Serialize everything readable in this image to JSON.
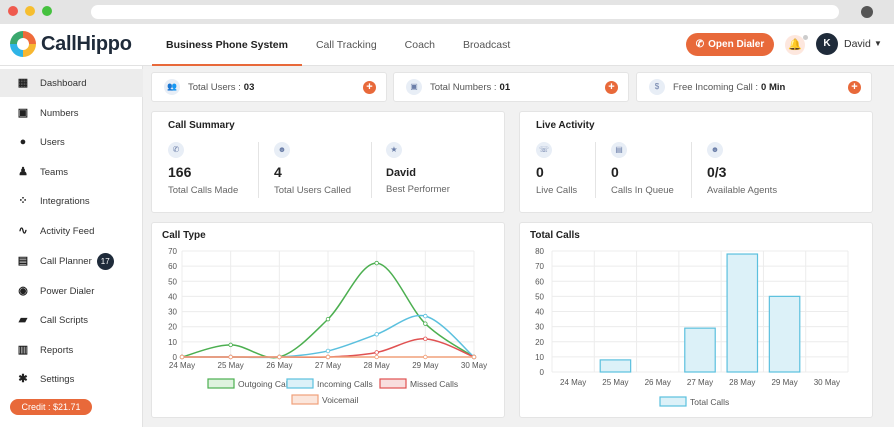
{
  "app": {
    "logo_text": "CallHippo"
  },
  "nav": {
    "tabs": [
      "Business Phone System",
      "Call Tracking",
      "Coach",
      "Broadcast"
    ]
  },
  "header": {
    "open_dialer": "Open Dialer",
    "avatar_initial": "K",
    "user_name": "David"
  },
  "sidebar": {
    "items": [
      {
        "label": "Dashboard",
        "icon": "dashboard-icon"
      },
      {
        "label": "Numbers",
        "icon": "numbers-icon"
      },
      {
        "label": "Users",
        "icon": "user-icon"
      },
      {
        "label": "Teams",
        "icon": "team-icon"
      },
      {
        "label": "Integrations",
        "icon": "integrations-icon"
      },
      {
        "label": "Activity Feed",
        "icon": "activity-icon"
      },
      {
        "label": "Call Planner",
        "icon": "calendar-icon",
        "badge": "17"
      },
      {
        "label": "Power Dialer",
        "icon": "power-dialer-icon"
      },
      {
        "label": "Call Scripts",
        "icon": "script-icon"
      },
      {
        "label": "Reports",
        "icon": "reports-icon"
      },
      {
        "label": "Settings",
        "icon": "gear-icon"
      }
    ],
    "credit": "Credit : $21.71"
  },
  "stats": {
    "total_users_label": "Total Users :",
    "total_users_value": "03",
    "total_numbers_label": "Total Numbers :",
    "total_numbers_value": "01",
    "free_incoming_label": "Free Incoming Call :",
    "free_incoming_value": "0 Min"
  },
  "call_summary": {
    "title": "Call Summary",
    "total_calls_made": "166",
    "total_calls_made_label": "Total Calls Made",
    "total_users_called": "4",
    "total_users_called_label": "Total Users Called",
    "best_performer": "David",
    "best_performer_label": "Best Performer"
  },
  "live_activity": {
    "title": "Live Activity",
    "live_calls": "0",
    "live_calls_label": "Live Calls",
    "calls_in_queue": "0",
    "calls_in_queue_label": "Calls In Queue",
    "available_agents": "0/3",
    "available_agents_label": "Available Agents"
  },
  "colors": {
    "accent": "#e8693a",
    "outgoing": "#4caf50",
    "incoming": "#5bc0de",
    "missed": "#e05252",
    "voicemail": "#f0a07a",
    "total": "#5bc0de"
  },
  "chart_data": [
    {
      "type": "line",
      "title": "Call Type",
      "categories": [
        "24 May",
        "25 May",
        "26 May",
        "27 May",
        "28 May",
        "29 May",
        "30 May"
      ],
      "ylim": [
        0,
        70
      ],
      "yticks": [
        0,
        10,
        20,
        30,
        40,
        50,
        60,
        70
      ],
      "grid": true,
      "legend_position": "bottom",
      "series": [
        {
          "name": "Outgoing Calls",
          "values": [
            0,
            8,
            0,
            25,
            62,
            22,
            0
          ]
        },
        {
          "name": "Incoming Calls",
          "values": [
            0,
            0,
            0,
            4,
            15,
            27,
            0
          ]
        },
        {
          "name": "Missed Calls",
          "values": [
            0,
            0,
            0,
            0,
            3,
            12,
            0
          ]
        },
        {
          "name": "Voicemail",
          "values": [
            0,
            0,
            0,
            0,
            0,
            0,
            0
          ]
        }
      ]
    },
    {
      "type": "bar",
      "title": "Total Calls",
      "categories": [
        "24 May",
        "25 May",
        "26 May",
        "27 May",
        "28 May",
        "29 May",
        "30 May"
      ],
      "ylim": [
        0,
        80
      ],
      "yticks": [
        0,
        10,
        20,
        30,
        40,
        50,
        60,
        70,
        80
      ],
      "grid": true,
      "legend_position": "bottom",
      "series": [
        {
          "name": "Total Calls",
          "values": [
            0,
            8,
            0,
            29,
            78,
            50,
            0
          ]
        }
      ]
    }
  ]
}
